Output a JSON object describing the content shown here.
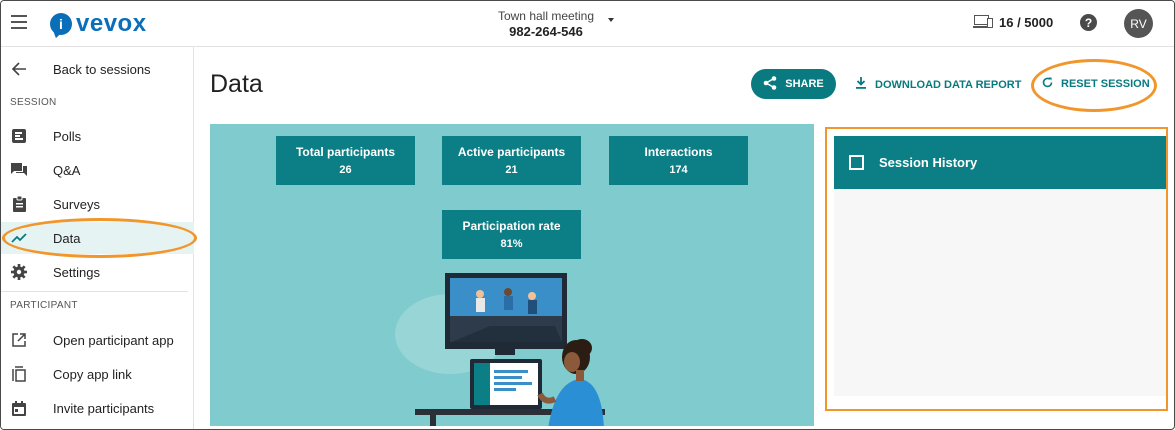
{
  "header": {
    "logo_text": "vevox",
    "meeting_title": "Town hall meeting",
    "meeting_code": "982-264-546",
    "devices_count": "16 / 5000",
    "help_icon": "question-icon",
    "avatar_initials": "RV"
  },
  "sidebar": {
    "back_label": "Back to sessions",
    "session_section": "SESSION",
    "session_items": [
      {
        "label": "Polls",
        "icon": "polls-icon"
      },
      {
        "label": "Q&A",
        "icon": "chat-icon"
      },
      {
        "label": "Surveys",
        "icon": "clipboard-icon"
      },
      {
        "label": "Data",
        "icon": "trend-icon",
        "active": true
      },
      {
        "label": "Settings",
        "icon": "gear-icon"
      }
    ],
    "participant_section": "PARTICIPANT",
    "participant_items": [
      {
        "label": "Open participant app",
        "icon": "external-link-icon"
      },
      {
        "label": "Copy app link",
        "icon": "copy-icon"
      },
      {
        "label": "Invite participants",
        "icon": "calendar-icon"
      }
    ]
  },
  "main": {
    "title": "Data",
    "share_label": "SHARE",
    "download_label": "DOWNLOAD DATA REPORT",
    "reset_label": "RESET SESSION",
    "stats": [
      {
        "label": "Total participants",
        "value": "26"
      },
      {
        "label": "Active participants",
        "value": "21"
      },
      {
        "label": "Interactions",
        "value": "174"
      },
      {
        "label": "Participation rate",
        "value": "81%"
      }
    ],
    "history_title": "Session History"
  },
  "colors": {
    "accent": "#0b7f85",
    "panel": "#7fcbcd",
    "highlight": "#f0962a",
    "brand": "#0a6fb8"
  }
}
